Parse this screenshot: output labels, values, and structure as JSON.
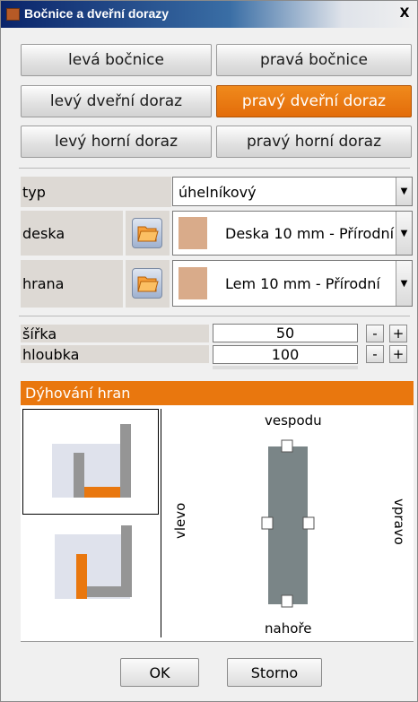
{
  "window": {
    "title": "Bočnice a dveřní dorazy",
    "close_label": "X"
  },
  "tabs": [
    {
      "label": "levá bočnice",
      "active": false
    },
    {
      "label": "pravá bočnice",
      "active": false
    },
    {
      "label": "levý dveřní doraz",
      "active": false
    },
    {
      "label": "pravý dveřní doraz",
      "active": true
    },
    {
      "label": "levý horní doraz",
      "active": false
    },
    {
      "label": "pravý horní doraz",
      "active": false
    }
  ],
  "fields": {
    "typ": {
      "label": "typ",
      "value": "úhelníkový"
    },
    "deska": {
      "label": "deska",
      "value": "Deska 10 mm - Přírodní"
    },
    "hrana": {
      "label": "hrana",
      "value": "Lem 10 mm - Přírodní"
    }
  },
  "dimensions": {
    "sirka": {
      "label": "šířka",
      "value": "50"
    },
    "hloubka": {
      "label": "hloubka",
      "value": "100"
    },
    "minus": "-",
    "plus": "+"
  },
  "edge_veneer": {
    "title": "Dýhování hran",
    "labels": {
      "bottom": "vespodu",
      "top": "nahoře",
      "left": "vlevo",
      "right": "vpravo"
    }
  },
  "footer": {
    "ok": "OK",
    "cancel": "Storno"
  },
  "colors": {
    "accent": "#e9770e",
    "titlebar": "#0a246a",
    "swatch": "#d9ab8a",
    "part_gray": "#959595"
  }
}
